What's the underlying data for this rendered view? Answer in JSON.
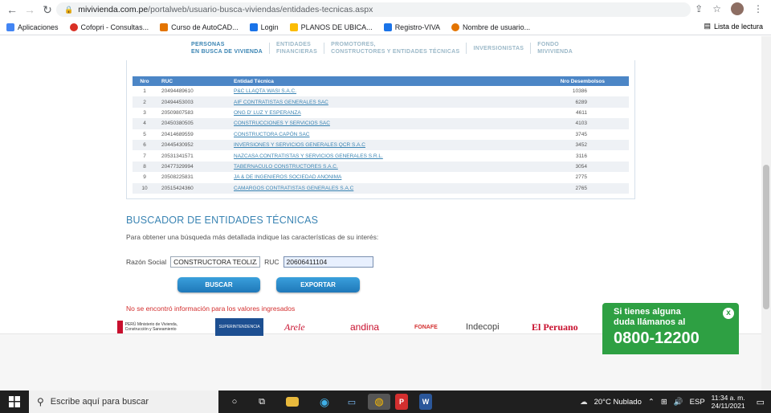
{
  "browser": {
    "url_domain": "mivivienda.com.pe",
    "url_path": "/portalweb/usuario-busca-viviendas/entidades-tecnicas.aspx",
    "bookmarks": [
      {
        "label": "Aplicaciones",
        "color": "#4285f4"
      },
      {
        "label": "Cofopri - Consultas...",
        "color": "#d93025"
      },
      {
        "label": "Curso de AutoCAD...",
        "color": "#e37400"
      },
      {
        "label": "Login",
        "color": "#1a73e8"
      },
      {
        "label": "PLANOS DE UBICA...",
        "color": "#fbbc04"
      },
      {
        "label": "Registro-VIVA",
        "color": "#1a73e8"
      },
      {
        "label": "Nombre de usuario...",
        "color": "#e37400"
      }
    ],
    "reading_list": "Lista de lectura"
  },
  "tabs": [
    {
      "line1": "PERSONAS",
      "line2": "EN BUSCA DE VIVIENDA",
      "active": true
    },
    {
      "line1": "ENTIDADES",
      "line2": "FINANCIERAS",
      "active": false
    },
    {
      "line1": "PROMOTORES,",
      "line2": "CONSTRUCTORES Y ENTIDADES TÉCNICAS",
      "active": false
    },
    {
      "line1": "INVERSIONISTAS",
      "line2": "",
      "active": false
    },
    {
      "line1": "FONDO",
      "line2": "MIVIVIENDA",
      "active": false
    }
  ],
  "table": {
    "headers": {
      "nro": "Nro",
      "ruc": "RUC",
      "entidad": "Entidad Técnica",
      "desembolsos": "Nro Desembolsos"
    },
    "rows": [
      {
        "nro": "1",
        "ruc": "20494489610",
        "entidad": "P&C LLAQTA WASI S.A.C.",
        "desembolsos": "10386"
      },
      {
        "nro": "2",
        "ruc": "20494453003",
        "entidad": "AIF CONTRATISTAS GENERALES SAC",
        "desembolsos": "6289"
      },
      {
        "nro": "3",
        "ruc": "20509807583",
        "entidad": "ONG D' LUZ Y ESPERANZA",
        "desembolsos": "4611"
      },
      {
        "nro": "4",
        "ruc": "20450380505",
        "entidad": "CONSTRUCCIONES Y SERVICIOS SAC",
        "desembolsos": "4103"
      },
      {
        "nro": "5",
        "ruc": "20414689559",
        "entidad": "CONSTRUCTORA CAPÓN SAC",
        "desembolsos": "3745"
      },
      {
        "nro": "6",
        "ruc": "20445430952",
        "entidad": "INVERSIONES Y SERVICIOS GENERALES QCR S.A.C",
        "desembolsos": "3452"
      },
      {
        "nro": "7",
        "ruc": "20531341571",
        "entidad": "NAZCASA CONTRATISTAS Y SERVICIOS GENERALES S.R.L.",
        "desembolsos": "3116"
      },
      {
        "nro": "8",
        "ruc": "20477329994",
        "entidad": "TABERNACULO CONSTRUCTORES S.A.C.",
        "desembolsos": "3054"
      },
      {
        "nro": "9",
        "ruc": "20508225831",
        "entidad": "JA & DE INGENIEROS SOCIEDAD ANONIMA",
        "desembolsos": "2775"
      },
      {
        "nro": "10",
        "ruc": "20515424360",
        "entidad": "CAMARGOS CONTRATISTAS GENERALES S.A.C",
        "desembolsos": "2765"
      }
    ]
  },
  "search": {
    "title": "BUSCADOR DE ENTIDADES TÉCNICAS",
    "subtitle": "Para obtener una búsqueda más detallada indique las características de su interés:",
    "razon_label": "Razón Social",
    "razon_value": "CONSTRUCTORA TEOLIZA",
    "ruc_label": "RUC",
    "ruc_value": "20606411104",
    "search_button": "BUSCAR",
    "export_button": "EXPORTAR",
    "error": "No se encontró información para los valores ingresados"
  },
  "footer": {
    "logos": [
      "PERÚ Ministerio de Vivienda, Construcción y Saneamiento",
      "SUPERINTENDENCIA",
      "Arele",
      "andina",
      "FONAFE",
      "Indecopi",
      "El Peruano"
    ],
    "callout_line1": "Si tienes alguna",
    "callout_line2": "duda llámanos al",
    "callout_phone": "0800-12200",
    "callout_close": "x"
  },
  "taskbar": {
    "search_placeholder": "Escribe aquí para buscar",
    "weather": "20°C  Nublado",
    "lang": "ESP",
    "time": "11:34 a. m.",
    "date": "24/11/2021"
  }
}
